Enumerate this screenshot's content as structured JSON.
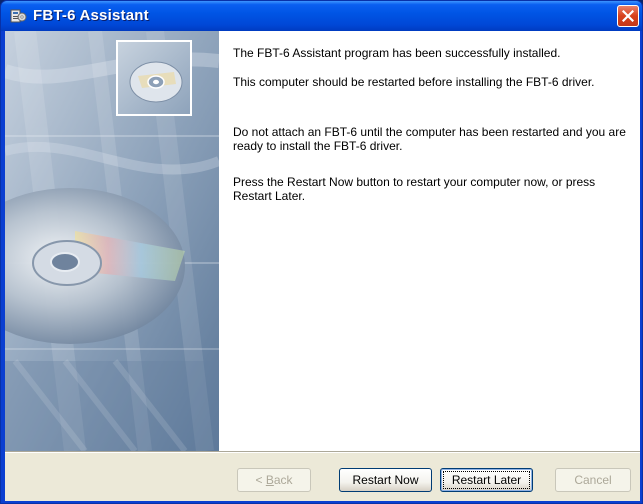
{
  "window": {
    "title": "FBT-6 Assistant"
  },
  "content": {
    "paragraphs": [
      "The FBT-6 Assistant program has been successfully installed.",
      "This computer should be restarted before installing the FBT-6 driver.",
      "Do not attach an FBT-6 until the computer has been restarted and you are ready to install the FBT-6 driver.",
      "Press the Restart Now button to restart your computer now, or press Restart Later."
    ]
  },
  "buttons": {
    "back": {
      "prefix": "< ",
      "accel": "B",
      "rest": "ack",
      "enabled": false
    },
    "restart_now": {
      "label": "Restart Now"
    },
    "restart_later": {
      "label": "Restart Later"
    },
    "cancel": {
      "label": "Cancel",
      "enabled": false
    }
  },
  "colors": {
    "titlebar": "#0055e5",
    "close": "#d7411b",
    "dialog_bg": "#ece9d8"
  }
}
